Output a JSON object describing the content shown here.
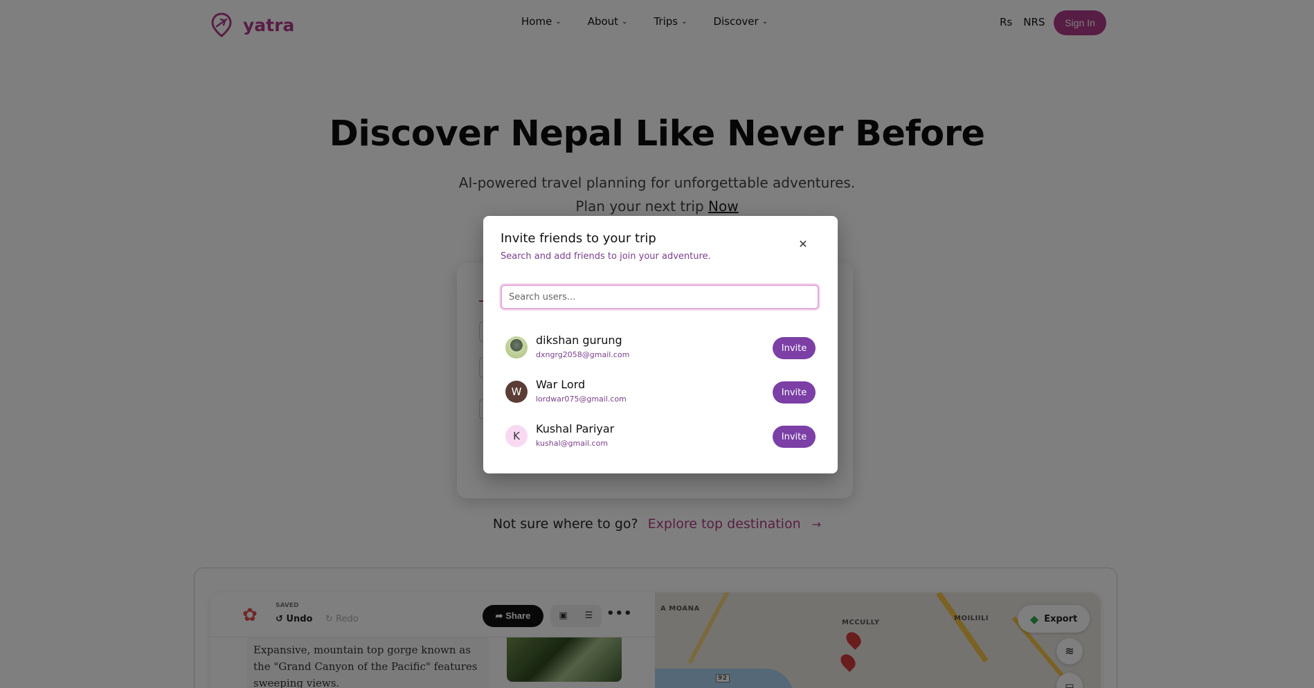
{
  "nav": {
    "logo_text": "yatra",
    "menu": [
      {
        "label": "Home"
      },
      {
        "label": "About"
      },
      {
        "label": "Trips"
      },
      {
        "label": "Discover"
      }
    ],
    "currency_symbol": "Rs",
    "currency_code": "NRS",
    "signin_label": "Sign In"
  },
  "hero": {
    "title": "Discover Nepal Like Never Before",
    "subtitle": "AI-powered travel planning for unforgettable adventures.",
    "plan_text": "Plan your next trip",
    "plan_link": "Now"
  },
  "explore": {
    "prompt": "Not sure where to go?",
    "link": "Explore top destination",
    "arrow": "→"
  },
  "preview": {
    "saved_label": "SAVED",
    "undo_label": "Undo",
    "redo_label": "Redo",
    "share_label": "Share",
    "description": "Expansive, mountain top gorge known as the \"Grand Canyon of the Pacific\" features sweeping views.",
    "map_labels": [
      "A MOANA",
      "MCCULLY",
      "MOILIILI"
    ],
    "road_number": "92",
    "export_label": "Export"
  },
  "modal": {
    "title": "Invite friends to your trip",
    "subtitle": "Search and add friends to join your adventure.",
    "search_placeholder": "Search users...",
    "invite_label": "Invite",
    "users": [
      {
        "name": "dikshan gurung",
        "email": "dxngrg2058@gmail.com",
        "initial": ""
      },
      {
        "name": "War Lord",
        "email": "lordwar075@gmail.com",
        "initial": "W"
      },
      {
        "name": "Kushal Pariyar",
        "email": "kushal@gmail.com",
        "initial": "K"
      }
    ]
  },
  "colors": {
    "brand": "#b03a8a",
    "invite_button": "#7b3fa6",
    "overlay": "rgba(0,0,0,0.5)"
  },
  "icons": [
    "logo-pin-icon",
    "chevron-down-icon",
    "close-icon",
    "undo-icon",
    "redo-icon",
    "share-icon",
    "image-icon",
    "list-icon",
    "more-icon",
    "google-maps-icon",
    "layers-icon",
    "bed-icon",
    "map-pin-icon",
    "arrow-right-icon"
  ]
}
